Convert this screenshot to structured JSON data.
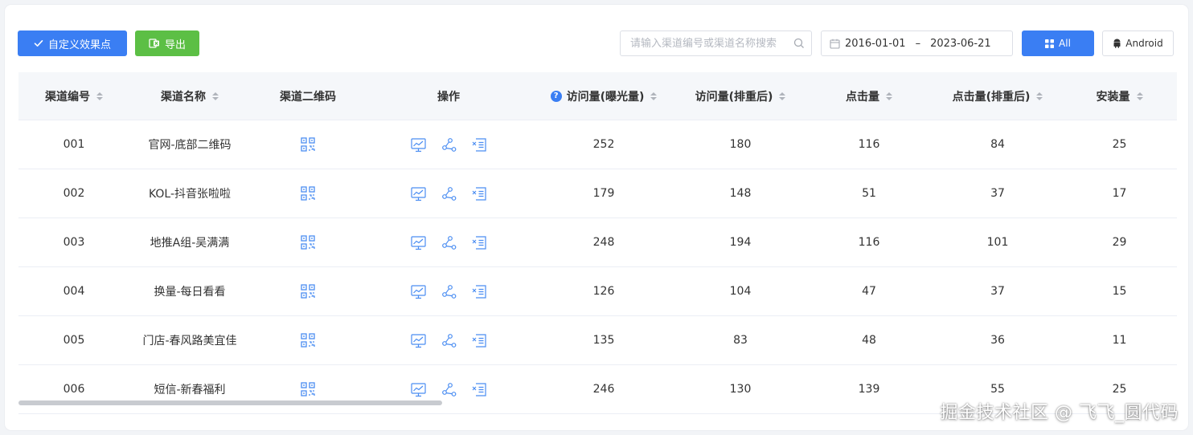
{
  "toolbar": {
    "custom_button_label": "自定义效果点",
    "export_button_label": "导出",
    "search_placeholder": "请输入渠道编号或渠道名称搜索",
    "date_start": "2016-01-01",
    "date_separator": "–",
    "date_end": "2023-06-21",
    "all_button_label": "All",
    "android_button_label": "Android"
  },
  "columns": {
    "channel_id": "渠道编号",
    "channel_name": "渠道名称",
    "qr_code": "渠道二维码",
    "actions": "操作",
    "visits": "访问量(曝光量)",
    "visits_dedup": "访问量(排重后)",
    "clicks": "点击量",
    "clicks_dedup": "点击量(排重后)",
    "installs": "安装量"
  },
  "rows": [
    {
      "id": "001",
      "name": "官网-底部二维码",
      "visits": "252",
      "visits_dedup": "180",
      "clicks": "116",
      "clicks_dedup": "84",
      "installs": "25"
    },
    {
      "id": "002",
      "name": "KOL-抖音张啦啦",
      "visits": "179",
      "visits_dedup": "148",
      "clicks": "51",
      "clicks_dedup": "37",
      "installs": "17"
    },
    {
      "id": "003",
      "name": "地推A组-吴满满",
      "visits": "248",
      "visits_dedup": "194",
      "clicks": "116",
      "clicks_dedup": "101",
      "installs": "29"
    },
    {
      "id": "004",
      "name": "换量-每日看看",
      "visits": "126",
      "visits_dedup": "104",
      "clicks": "47",
      "clicks_dedup": "37",
      "installs": "15"
    },
    {
      "id": "005",
      "name": "门店-春风路美宜佳",
      "visits": "135",
      "visits_dedup": "83",
      "clicks": "48",
      "clicks_dedup": "36",
      "installs": "11"
    },
    {
      "id": "006",
      "name": "短信-新春福利",
      "visits": "246",
      "visits_dedup": "130",
      "clicks": "139",
      "clicks_dedup": "55",
      "installs": "25"
    }
  ],
  "watermark": "掘金技术社区 @ 飞飞_圆代码",
  "colors": {
    "primary": "#3a7ef3",
    "success": "#5cbf45",
    "header_bg": "#f5f7fa",
    "icon_blue": "#4a8df2"
  },
  "icons": {
    "custom_button": "check-icon",
    "export_button": "excel-icon",
    "search": "search-icon",
    "date": "calendar-icon",
    "all_button": "grid-icon",
    "android_button": "android-icon",
    "qr": "qrcode-icon",
    "op_chart": "chart-icon",
    "op_share": "share-icon",
    "op_detail": "detail-list-icon",
    "help": "question-icon"
  }
}
